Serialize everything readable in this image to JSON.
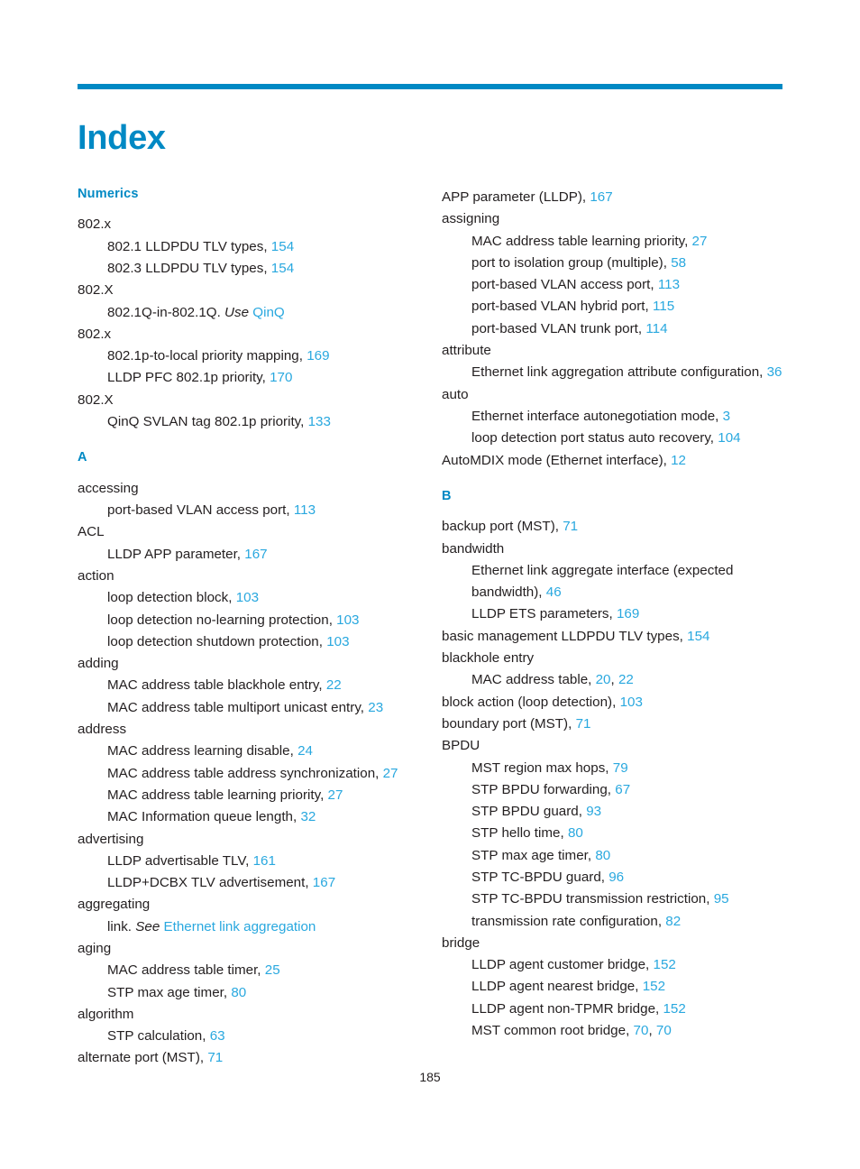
{
  "page": {
    "title": "Index",
    "folio": "185",
    "accent_color": "#0089c4",
    "link_color": "#29a8df",
    "text_color": "#231f20"
  },
  "columns": [
    {
      "name": "left-column",
      "sections": [
        {
          "heading": "Numerics",
          "entries": [
            {
              "level": 1,
              "text": "802.x"
            },
            {
              "level": 2,
              "text": "802.1 LLDPDU TLV types,",
              "page": "154"
            },
            {
              "level": 2,
              "text": "802.3 LLDPDU TLV types,",
              "page": "154"
            },
            {
              "level": 1,
              "text": "802.X"
            },
            {
              "level": 2,
              "text": "802.1Q-in-802.1Q.",
              "italic": "Use",
              "xref": "QinQ"
            },
            {
              "level": 1,
              "text": "802.x"
            },
            {
              "level": 2,
              "text": "802.1p-to-local priority mapping,",
              "page": "169"
            },
            {
              "level": 2,
              "text": "LLDP PFC 802.1p priority,",
              "page": "170"
            },
            {
              "level": 1,
              "text": "802.X"
            },
            {
              "level": 2,
              "text": "QinQ SVLAN tag 802.1p priority,",
              "page": "133"
            }
          ]
        },
        {
          "heading": "A",
          "entries": [
            {
              "level": 1,
              "text": "accessing"
            },
            {
              "level": 2,
              "text": "port-based VLAN access port,",
              "page": "113"
            },
            {
              "level": 1,
              "text": "ACL"
            },
            {
              "level": 2,
              "text": "LLDP APP parameter,",
              "page": "167"
            },
            {
              "level": 1,
              "text": "action"
            },
            {
              "level": 2,
              "text": "loop detection block,",
              "page": "103"
            },
            {
              "level": 2,
              "text": "loop detection no-learning protection,",
              "page": "103"
            },
            {
              "level": 2,
              "text": "loop detection shutdown protection,",
              "page": "103"
            },
            {
              "level": 1,
              "text": "adding"
            },
            {
              "level": 2,
              "text": "MAC address table blackhole entry,",
              "page": "22"
            },
            {
              "level": 2,
              "text": "MAC address table multiport unicast entry,",
              "page": "23"
            },
            {
              "level": 1,
              "text": "address"
            },
            {
              "level": 2,
              "text": "MAC address learning disable,",
              "page": "24"
            },
            {
              "level": 2,
              "text": "MAC address table address synchronization,",
              "page": "27"
            },
            {
              "level": 2,
              "text": "MAC address table learning priority,",
              "page": "27"
            },
            {
              "level": 2,
              "text": "MAC Information queue length,",
              "page": "32"
            },
            {
              "level": 1,
              "text": "advertising"
            },
            {
              "level": 2,
              "text": "LLDP advertisable TLV,",
              "page": "161"
            },
            {
              "level": 2,
              "text": "LLDP+DCBX TLV advertisement,",
              "page": "167"
            },
            {
              "level": 1,
              "text": "aggregating"
            },
            {
              "level": 2,
              "text": "link.",
              "italic": "See",
              "xref": "Ethernet link aggregation"
            },
            {
              "level": 1,
              "text": "aging"
            },
            {
              "level": 2,
              "text": "MAC address table timer,",
              "page": "25"
            },
            {
              "level": 2,
              "text": "STP max age timer,",
              "page": "80"
            },
            {
              "level": 1,
              "text": "algorithm"
            },
            {
              "level": 2,
              "text": "STP calculation,",
              "page": "63"
            },
            {
              "level": 1,
              "text": "alternate port (MST),",
              "page": "71"
            }
          ]
        }
      ]
    },
    {
      "name": "right-column",
      "sections": [
        {
          "heading": null,
          "entries": [
            {
              "level": 1,
              "text": "APP parameter (LLDP),",
              "page": "167"
            },
            {
              "level": 1,
              "text": "assigning"
            },
            {
              "level": 2,
              "text": "MAC address table learning priority,",
              "page": "27"
            },
            {
              "level": 2,
              "text": "port to isolation group (multiple),",
              "page": "58"
            },
            {
              "level": 2,
              "text": "port-based VLAN access port,",
              "page": "113"
            },
            {
              "level": 2,
              "text": "port-based VLAN hybrid port,",
              "page": "115"
            },
            {
              "level": 2,
              "text": "port-based VLAN trunk port,",
              "page": "114"
            },
            {
              "level": 1,
              "text": "attribute"
            },
            {
              "level": 2,
              "text": "Ethernet link aggregation attribute configuration,",
              "page": "36"
            },
            {
              "level": 1,
              "text": "auto"
            },
            {
              "level": 2,
              "text": "Ethernet interface autonegotiation mode,",
              "page": "3"
            },
            {
              "level": 2,
              "text": "loop detection port status auto recovery,",
              "page": "104"
            },
            {
              "level": 1,
              "text": "AutoMDIX mode (Ethernet interface),",
              "page": "12"
            }
          ]
        },
        {
          "heading": "B",
          "entries": [
            {
              "level": 1,
              "text": "backup port (MST),",
              "page": "71"
            },
            {
              "level": 1,
              "text": "bandwidth"
            },
            {
              "level": 2,
              "text": "Ethernet link aggregate interface (expected bandwidth),",
              "page": "46"
            },
            {
              "level": 2,
              "text": "LLDP ETS parameters,",
              "page": "169"
            },
            {
              "level": 1,
              "text": "basic management LLDPDU TLV types,",
              "page": "154"
            },
            {
              "level": 1,
              "text": "blackhole entry"
            },
            {
              "level": 2,
              "text": "MAC address table,",
              "page": "20",
              "page2": "22"
            },
            {
              "level": 1,
              "text": "block action (loop detection),",
              "page": "103"
            },
            {
              "level": 1,
              "text": "boundary port (MST),",
              "page": "71"
            },
            {
              "level": 1,
              "text": "BPDU"
            },
            {
              "level": 2,
              "text": "MST region max hops,",
              "page": "79"
            },
            {
              "level": 2,
              "text": "STP BPDU forwarding,",
              "page": "67"
            },
            {
              "level": 2,
              "text": "STP BPDU guard,",
              "page": "93"
            },
            {
              "level": 2,
              "text": "STP hello time,",
              "page": "80"
            },
            {
              "level": 2,
              "text": "STP max age timer,",
              "page": "80"
            },
            {
              "level": 2,
              "text": "STP TC-BPDU guard,",
              "page": "96"
            },
            {
              "level": 2,
              "text": "STP TC-BPDU transmission restriction,",
              "page": "95"
            },
            {
              "level": 2,
              "text": "transmission rate configuration,",
              "page": "82"
            },
            {
              "level": 1,
              "text": "bridge"
            },
            {
              "level": 2,
              "text": "LLDP agent customer bridge,",
              "page": "152"
            },
            {
              "level": 2,
              "text": "LLDP agent nearest bridge,",
              "page": "152"
            },
            {
              "level": 2,
              "text": "LLDP agent non-TPMR bridge,",
              "page": "152"
            },
            {
              "level": 2,
              "text": "MST common root bridge,",
              "page": "70",
              "page2": "70"
            }
          ]
        }
      ]
    }
  ]
}
